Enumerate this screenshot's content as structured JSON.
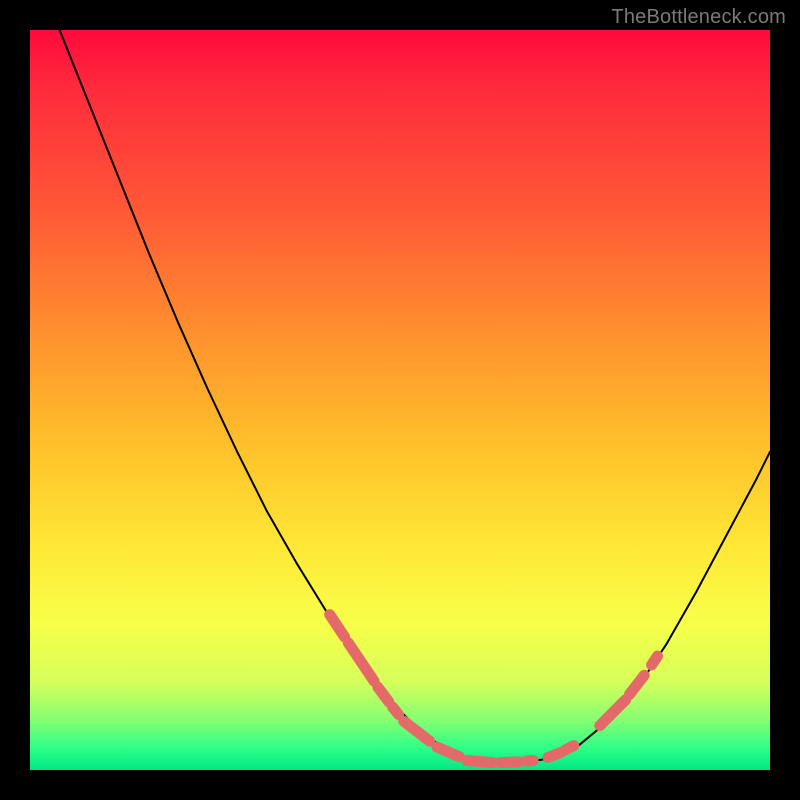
{
  "watermark": "TheBottleneck.com",
  "chart_data": {
    "type": "line",
    "title": "",
    "xlabel": "",
    "ylabel": "",
    "xlim": [
      0,
      100
    ],
    "ylim": [
      0,
      100
    ],
    "series": [
      {
        "name": "bottleneck-curve",
        "x": [
          4,
          8,
          12,
          16,
          20,
          24,
          28,
          32,
          36,
          40,
          44,
          46,
          48,
          50,
          52,
          54,
          56,
          58,
          60,
          62,
          66,
          70,
          74,
          78,
          82,
          86,
          90,
          94,
          98,
          100
        ],
        "y": [
          100,
          90,
          80,
          70,
          60.5,
          51.5,
          43,
          35,
          28,
          21.5,
          15.5,
          12.8,
          10.2,
          8,
          6,
          4.3,
          3,
          2,
          1.3,
          1,
          1,
          1.5,
          3.2,
          6.5,
          11,
          17,
          24,
          31.5,
          39,
          43
        ]
      }
    ],
    "markers": [
      {
        "name": "highlight-segments",
        "color": "#e46a6a",
        "segments": [
          {
            "x": [
              40.5,
              42.5
            ],
            "y": [
              21,
              18
            ]
          },
          {
            "x": [
              43,
              46.5
            ],
            "y": [
              17.2,
              12
            ]
          },
          {
            "x": [
              47,
              48.5
            ],
            "y": [
              11.2,
              9.2
            ]
          },
          {
            "x": [
              49,
              49.8
            ],
            "y": [
              8.5,
              7.5
            ]
          },
          {
            "x": [
              50.5,
              54
            ],
            "y": [
              6.6,
              3.9
            ]
          },
          {
            "x": [
              55,
              58
            ],
            "y": [
              3.1,
              1.8
            ]
          },
          {
            "x": [
              59,
              62.5
            ],
            "y": [
              1.3,
              1.0
            ]
          },
          {
            "x": [
              63.5,
              66
            ],
            "y": [
              1.0,
              1.1
            ]
          },
          {
            "x": [
              67,
              68
            ],
            "y": [
              1.2,
              1.3
            ]
          },
          {
            "x": [
              70,
              71.8
            ],
            "y": [
              1.7,
              2.4
            ]
          },
          {
            "x": [
              72.3,
              73.5
            ],
            "y": [
              2.7,
              3.3
            ]
          },
          {
            "x": [
              77,
              80.5
            ],
            "y": [
              6.0,
              9.5
            ]
          },
          {
            "x": [
              81,
              83
            ],
            "y": [
              10.2,
              12.8
            ]
          },
          {
            "x": [
              84,
              84.8
            ],
            "y": [
              14.2,
              15.4
            ]
          }
        ]
      }
    ],
    "background_gradient": {
      "top": "#ff0a3c",
      "mid": "#ffe836",
      "bottom": "#00e884"
    }
  }
}
